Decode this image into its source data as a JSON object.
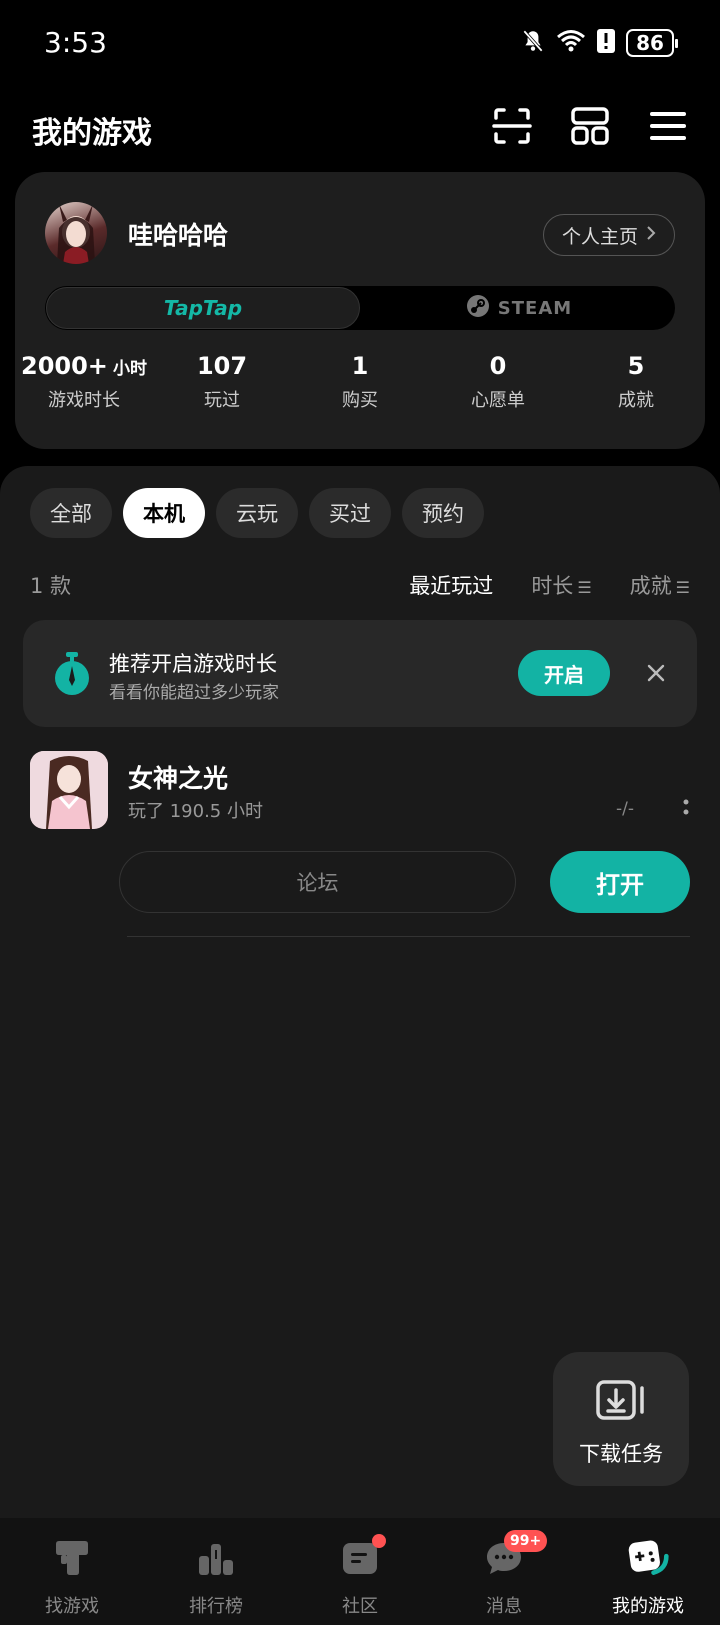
{
  "status_bar": {
    "time": "3:53",
    "battery": "86"
  },
  "header": {
    "title": "我的游戏"
  },
  "profile": {
    "username": "哇哈哈哈",
    "homepage_label": "个人主页",
    "platforms": {
      "taptap": "TapTap",
      "steam": "STEAM"
    },
    "stats": [
      {
        "value": "2000+",
        "unit": "小时",
        "label": "游戏时长"
      },
      {
        "value": "107",
        "unit": "",
        "label": "玩过"
      },
      {
        "value": "1",
        "unit": "",
        "label": "购买"
      },
      {
        "value": "0",
        "unit": "",
        "label": "心愿单"
      },
      {
        "value": "5",
        "unit": "",
        "label": "成就"
      }
    ]
  },
  "filters": [
    "全部",
    "本机",
    "云玩",
    "买过",
    "预约"
  ],
  "active_filter": "本机",
  "list_meta": {
    "count": "1 款",
    "sort_options": [
      "最近玩过",
      "时长",
      "成就"
    ],
    "active_sort": "最近玩过"
  },
  "banner": {
    "title": "推荐开启游戏时长",
    "subtitle": "看看你能超过多少玩家",
    "action_label": "开启"
  },
  "games": [
    {
      "title": "女神之光",
      "playtime": "玩了 190.5 小时",
      "dash": "-/-",
      "forum_label": "论坛",
      "open_label": "打开"
    }
  ],
  "download_fab": {
    "label": "下载任务"
  },
  "bottom_nav": [
    {
      "label": "找游戏",
      "icon": "find-game-icon"
    },
    {
      "label": "排行榜",
      "icon": "ranking-icon"
    },
    {
      "label": "社区",
      "icon": "community-icon"
    },
    {
      "label": "消息",
      "icon": "message-icon",
      "badge": "99+"
    },
    {
      "label": "我的游戏",
      "icon": "my-games-icon"
    }
  ],
  "colors": {
    "accent": "#13b3a4",
    "badge": "#ff5252",
    "background": "#1a1a1a"
  }
}
